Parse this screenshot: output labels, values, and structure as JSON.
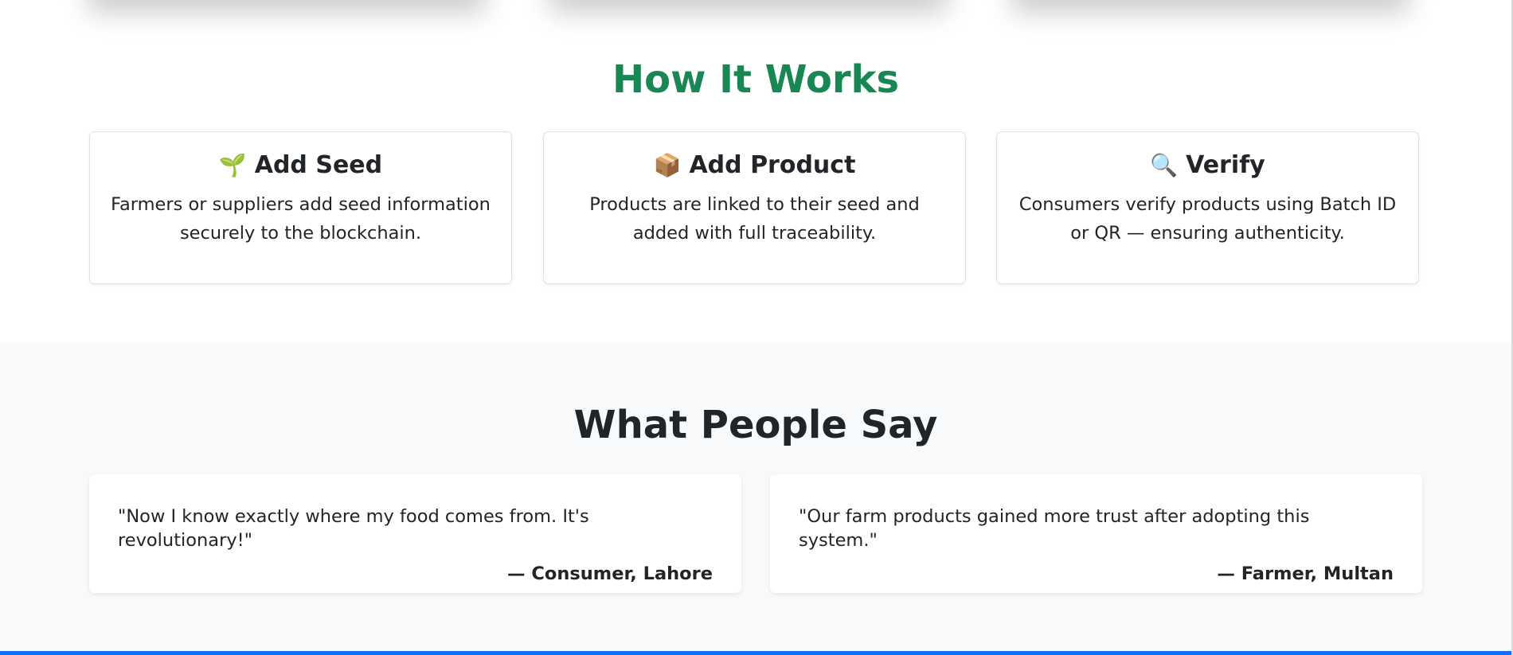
{
  "how_it_works": {
    "title": "How It Works",
    "title_color": "#198754",
    "steps": [
      {
        "icon": "seedling-icon",
        "glyph": "🌱",
        "title": "Add Seed",
        "description": "Farmers or suppliers add seed information securely to the blockchain."
      },
      {
        "icon": "package-icon",
        "glyph": "📦",
        "title": "Add Product",
        "description": "Products are linked to their seed and added with full traceability."
      },
      {
        "icon": "magnifier-icon",
        "glyph": "🔍",
        "title": "Verify",
        "description": "Consumers verify products using Batch ID or QR — ensuring authenticity."
      }
    ]
  },
  "testimonials": {
    "title": "What People Say",
    "items": [
      {
        "quote": "\"Now I know exactly where my food comes from. It's revolutionary!\"",
        "author": "— Consumer, Lahore"
      },
      {
        "quote": "\"Our farm products gained more trust after adopting this system.\"",
        "author": "— Farmer, Multan"
      }
    ]
  },
  "colors": {
    "accent_green": "#198754",
    "footer_bar": "#0d6efd",
    "section_alt_bg": "#f8f9fa"
  }
}
